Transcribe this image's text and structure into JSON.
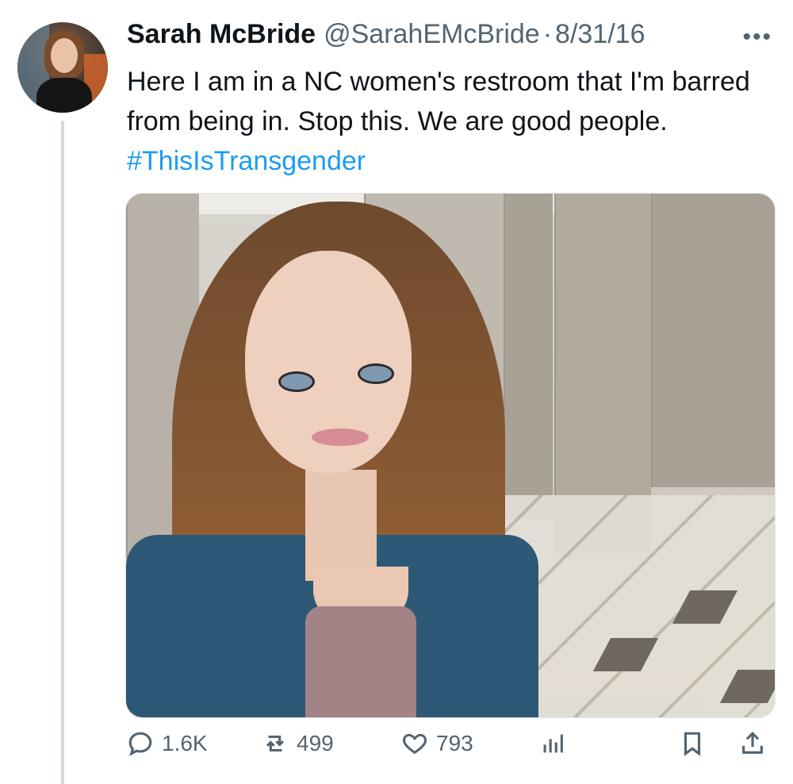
{
  "tweet": {
    "author_name": "Sarah McBride",
    "handle": "@SarahEMcBride",
    "separator": "·",
    "date": "8/31/16",
    "text": "Here I am in a NC women's restroom that I'm barred from being in. Stop this. We are good people.",
    "hashtag": "#ThisIsTransgender"
  },
  "actions": {
    "replies": "1.6K",
    "retweets": "499",
    "likes": "793"
  },
  "icons": {
    "more": "more-icon",
    "reply": "reply-icon",
    "retweet": "retweet-icon",
    "like": "heart-icon",
    "views": "analytics-icon",
    "bookmark": "bookmark-icon",
    "share": "share-icon"
  },
  "colors": {
    "text": "#0f1419",
    "secondary": "#536471",
    "hashtag": "#1d9bf0"
  }
}
